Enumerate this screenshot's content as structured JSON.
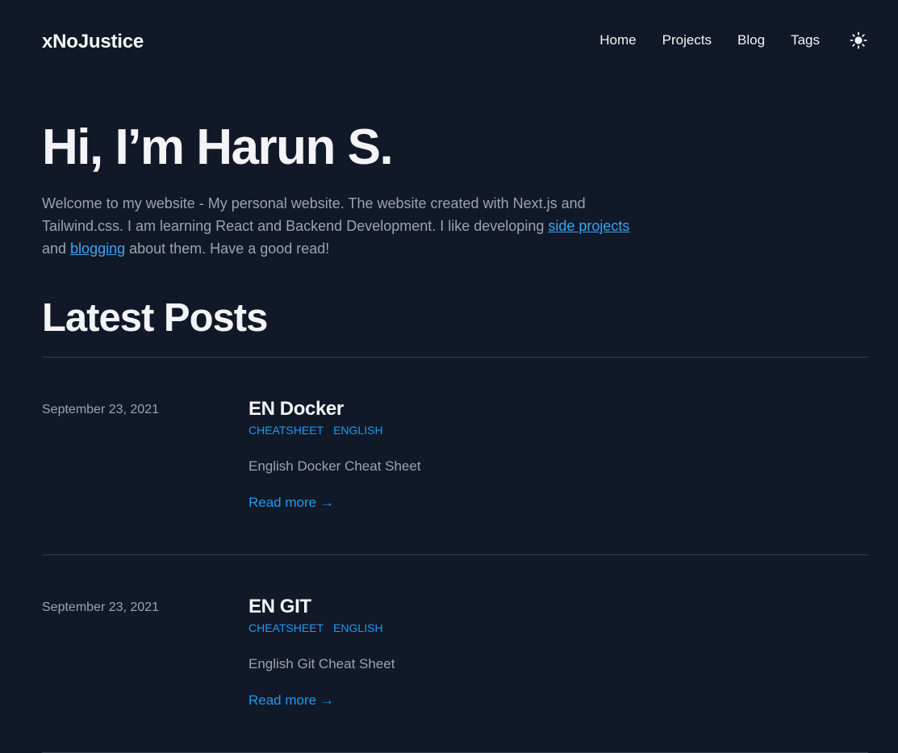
{
  "header": {
    "brand": "xNoJustice",
    "nav": [
      {
        "label": "Home"
      },
      {
        "label": "Projects"
      },
      {
        "label": "Blog"
      },
      {
        "label": "Tags"
      }
    ],
    "theme_icon": "sun-icon"
  },
  "hero": {
    "title": "Hi, I’m Harun S.",
    "text_part1": "Welcome to my website - My personal website. The website created with Next.js and Tailwind.css. I am learning React and Backend Development. I like developing ",
    "link_projects": "side projects",
    "text_part2": " and ",
    "link_blogging": "blogging",
    "text_part3": " about them. Have a good read!"
  },
  "latest": {
    "title": "Latest Posts",
    "posts": [
      {
        "date": "September 23, 2021",
        "title": "EN Docker",
        "tags": [
          "CHEATSHEET",
          "ENGLISH"
        ],
        "summary": "English Docker Cheat Sheet",
        "read_more": "Read more →"
      },
      {
        "date": "September 23, 2021",
        "title": "EN GIT",
        "tags": [
          "CHEATSHEET",
          "ENGLISH"
        ],
        "summary": "English Git Cheat Sheet",
        "read_more": "Read more →"
      }
    ]
  },
  "colors": {
    "background": "#111827",
    "text": "#f3f4f6",
    "muted": "#9ca3af",
    "accent": "#1d9bf0",
    "divider": "#374151"
  }
}
